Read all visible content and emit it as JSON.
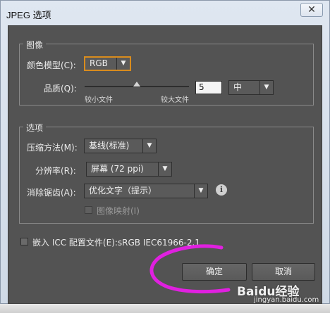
{
  "window": {
    "title": "JPEG 选项",
    "close_glyph": "✕"
  },
  "image_group": {
    "title": "图像",
    "color_model": {
      "label": "颜色模型(C):",
      "value": "RGB"
    },
    "quality": {
      "label": "品质(Q):",
      "value": "5",
      "level_fraction": 0.5,
      "min_label": "较小文件",
      "max_label": "较大文件",
      "preset": "中"
    }
  },
  "options_group": {
    "title": "选项",
    "compression": {
      "label": "压缩方法(M):",
      "value": "基线(标准)"
    },
    "resolution": {
      "label": "分辨率(R):",
      "value": "屏幕 (72 ppi)"
    },
    "antialiasing": {
      "label": "消除锯齿(A):",
      "value": "优化文字（提示）"
    },
    "imagemap": {
      "label": "图像映射(I)",
      "checked": false,
      "enabled": false
    }
  },
  "embed_icc": {
    "label": "嵌入 ICC 配置文件(E):sRGB IEC61966-2.1",
    "checked": false
  },
  "buttons": {
    "ok": "确定",
    "cancel": "取消"
  },
  "watermark": {
    "text": "Baidu经验",
    "url": "jingyan.baidu.com"
  },
  "colors": {
    "annotation": "#e020e0",
    "dialog_bg": "#535353"
  },
  "icons": {
    "info": "info-icon",
    "dropdown": "chevron-down-icon"
  }
}
